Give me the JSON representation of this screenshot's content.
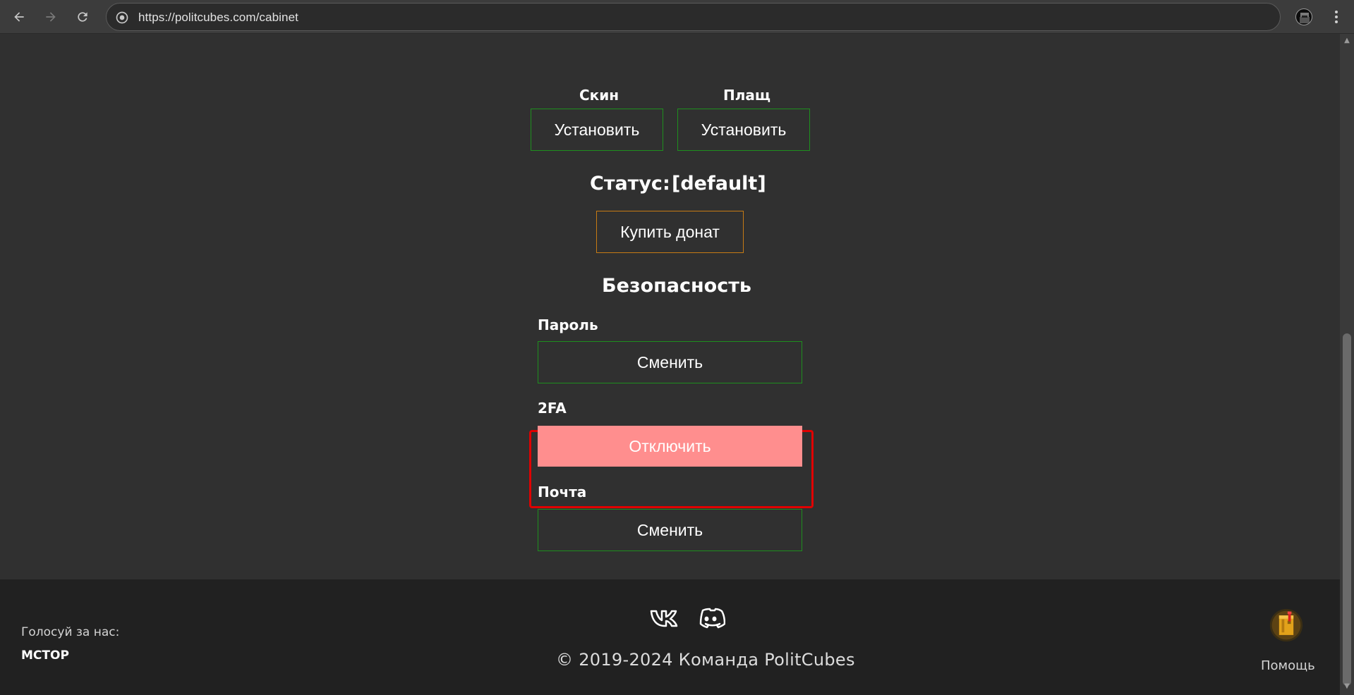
{
  "browser": {
    "url": "https://politcubes.com/cabinet"
  },
  "profile": {
    "skin_label": "Скин",
    "skin_button": "Установить",
    "cloak_label": "Плащ",
    "cloak_button": "Установить",
    "status_label": "Статус:",
    "status_value": "[default]",
    "donate_button": "Купить донат"
  },
  "security": {
    "title": "Безопасность",
    "password_label": "Пароль",
    "password_button": "Сменить",
    "twofa_label": "2FA",
    "twofa_button": "Отключить",
    "mail_label": "Почта",
    "mail_button": "Сменить"
  },
  "footer": {
    "vote_label": "Голосуй за нас:",
    "vote_link": "MCTOP",
    "copyright": "© 2019-2024 Команда PolitCubes",
    "help_label": "Помощь"
  },
  "colors": {
    "background": "#303030",
    "footer": "#212121",
    "green_border": "#1e8f1e",
    "orange_border": "#c67b14",
    "danger_button": "#ff8e8e",
    "highlight": "#e00000"
  },
  "icons": [
    "back-arrow-icon",
    "forward-arrow-icon",
    "reload-icon",
    "site-info-icon",
    "profile-icon",
    "menu-icon",
    "vk-icon",
    "discord-icon",
    "help-icon"
  ]
}
